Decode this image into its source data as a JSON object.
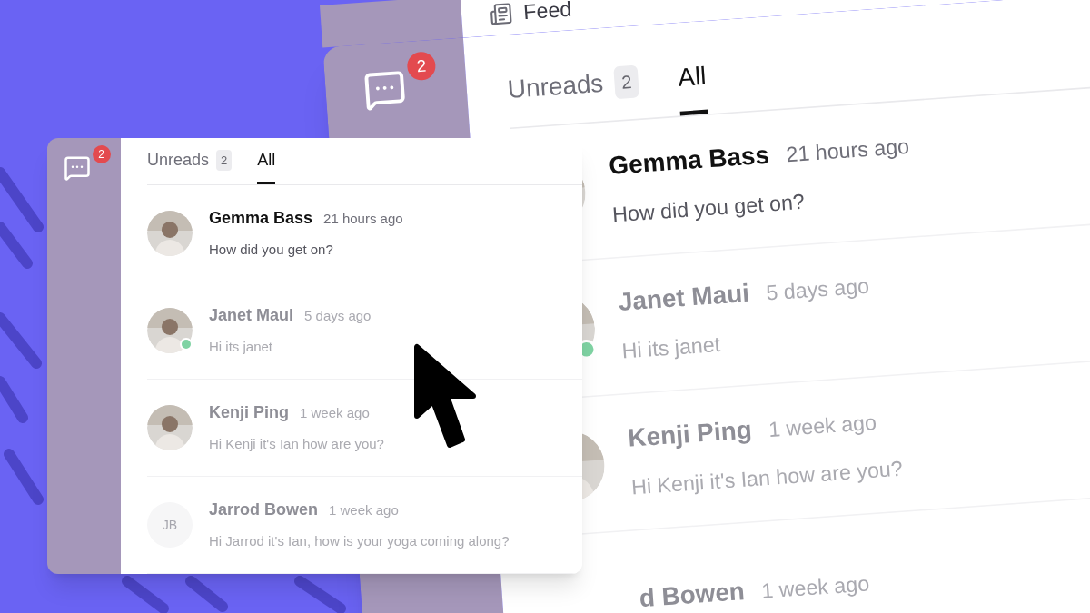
{
  "background_panel": {
    "nav": {
      "label": "Feed"
    },
    "badge": "2",
    "tabs": [
      {
        "label": "Unreads",
        "count": "2",
        "selected": false
      },
      {
        "label": "All",
        "selected": true
      }
    ],
    "messages": [
      {
        "name": "Gemma Bass",
        "time": "21 hours ago",
        "text": "How did you get on?",
        "unread": true,
        "online": false,
        "avatar": {
          "kind": "photo"
        }
      },
      {
        "name": "Janet Maui",
        "time": "5 days ago",
        "text": "Hi its janet",
        "unread": false,
        "online": true,
        "avatar": {
          "kind": "photo"
        }
      },
      {
        "name": "Kenji Ping",
        "time": "1 week ago",
        "text": "Hi Kenji it's Ian how are you?",
        "unread": false,
        "online": false,
        "avatar": {
          "kind": "photo"
        }
      },
      {
        "name": "d Bowen",
        "time": "1 week ago",
        "unread": false
      }
    ]
  },
  "panel": {
    "badge": "2",
    "tabs": [
      {
        "label": "Unreads",
        "count": "2",
        "selected": false
      },
      {
        "label": "All",
        "selected": true
      }
    ],
    "messages": [
      {
        "name": "Gemma Bass",
        "time": "21 hours ago",
        "text": "How did you get on?",
        "unread": true,
        "online": false,
        "avatar": {
          "kind": "photo"
        }
      },
      {
        "name": "Janet Maui",
        "time": "5 days ago",
        "text": "Hi its janet",
        "unread": false,
        "online": true,
        "avatar": {
          "kind": "photo"
        }
      },
      {
        "name": "Kenji Ping",
        "time": "1 week ago",
        "text": "Hi Kenji it's Ian how are you?",
        "unread": false,
        "online": false,
        "avatar": {
          "kind": "photo"
        }
      },
      {
        "name": "Jarrod Bowen",
        "time": "1 week ago",
        "text": "Hi Jarrod it's Ian, how is your yoga coming along?",
        "unread": false,
        "online": false,
        "avatar": {
          "kind": "initials",
          "initials": "JB"
        }
      }
    ]
  }
}
